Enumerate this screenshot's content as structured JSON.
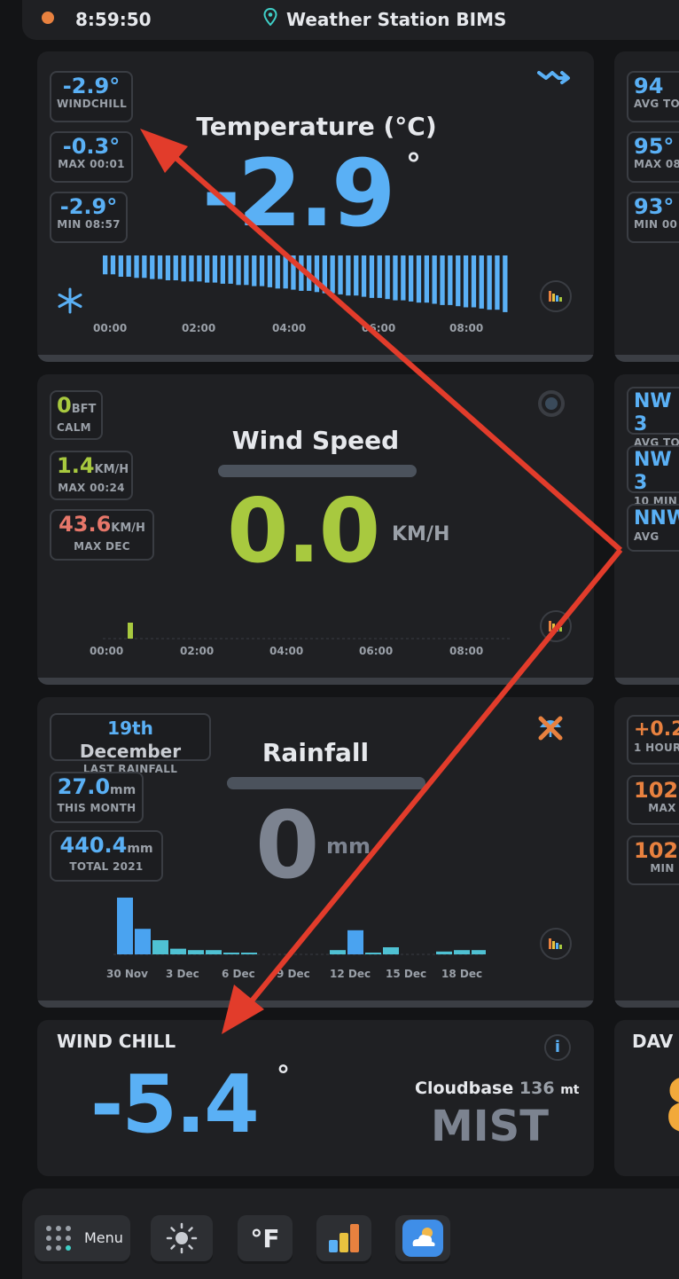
{
  "header": {
    "time": "8:59:50",
    "station": "Weather Station BIMS"
  },
  "temperature": {
    "title": "Temperature (°C)",
    "value": "-2.9",
    "unit": "°",
    "stats": [
      {
        "value": "-2.9°",
        "label": "WINDCHILL"
      },
      {
        "value": "-0.3°",
        "label": "MAX 00:01"
      },
      {
        "value": "-2.9°",
        "label": "MIN 08:57"
      }
    ],
    "axis": [
      "00:00",
      "02:00",
      "04:00",
      "06:00",
      "08:00"
    ],
    "trend": [
      0.9,
      0.9,
      0.88,
      0.88,
      0.87,
      0.87,
      0.86,
      0.86,
      0.85,
      0.85,
      0.84,
      0.84,
      0.84,
      0.83,
      0.83,
      0.82,
      0.82,
      0.81,
      0.81,
      0.8,
      0.8,
      0.79,
      0.78,
      0.78,
      0.77,
      0.76,
      0.76,
      0.75,
      0.74,
      0.74,
      0.73,
      0.72,
      0.72,
      0.71,
      0.7,
      0.7,
      0.69,
      0.68,
      0.68,
      0.67,
      0.66,
      0.66,
      0.65,
      0.64,
      0.64,
      0.63,
      0.62,
      0.62,
      0.61,
      0.6,
      0.6,
      0.58
    ]
  },
  "side_temp": [
    {
      "value": "94",
      "label": "AVG TO"
    },
    {
      "value": "95°",
      "label": "MAX 08"
    },
    {
      "value": "93°",
      "label": "MIN 00"
    }
  ],
  "wind": {
    "title": "Wind Speed",
    "value": "0.0",
    "unit": "KM/H",
    "stats": [
      {
        "value": "0",
        "unit": "BFT",
        "label": "CALM"
      },
      {
        "value": "1.4",
        "unit": "KM/H",
        "label": "MAX 00:24"
      },
      {
        "value": "43.6",
        "unit": "KM/H",
        "label": "MAX DEC"
      }
    ],
    "axis": [
      "00:00",
      "02:00",
      "04:00",
      "06:00",
      "08:00"
    ],
    "bar_value": 0.4
  },
  "side_wind": [
    {
      "value": "NW 3",
      "label": "AVG TO"
    },
    {
      "value": "NW 3",
      "label": "10 MIN"
    },
    {
      "value": "NNW",
      "label": "AVG"
    }
  ],
  "rain": {
    "title": "Rainfall",
    "value": "0",
    "unit": "mm",
    "stats": [
      {
        "value": "19th",
        "value2": "December",
        "label": "LAST RAINFALL"
      },
      {
        "value": "27.0",
        "unit": "mm",
        "label": "THIS MONTH"
      },
      {
        "value": "440.4",
        "unit": "mm",
        "label": "TOTAL 2021"
      }
    ],
    "axis": [
      "30 Nov",
      "3 Dec",
      "6 Dec",
      "9 Dec",
      "12 Dec",
      "15 Dec",
      "18 Dec"
    ],
    "daily_mm": [
      4.0,
      1.8,
      1.0,
      0.4,
      0.3,
      0.3,
      0.1,
      0.1,
      0,
      0,
      0,
      0,
      0.3,
      1.7,
      0.1,
      0.5,
      0,
      0,
      0.2,
      0.3,
      0.3
    ],
    "daily_color": [
      "#4aa3f0",
      "#4aa3f0",
      "#4fc1d3",
      "#4fc1d3",
      "#4fc1d3",
      "#4fc1d3",
      "#4fc1d3",
      "#4fc1d3",
      "#4fc1d3",
      "#4fc1d3",
      "#4fc1d3",
      "#4fc1d3",
      "#4fc1d3",
      "#4aa3f0",
      "#4fc1d3",
      "#4fc1d3",
      "#4fc1d3",
      "#4fc1d3",
      "#4fc1d3",
      "#4fc1d3",
      "#4fc1d3"
    ]
  },
  "side_rain": [
    {
      "value": "+0.2",
      "label": "1 HOUR"
    },
    {
      "value": "102",
      "label": "MAX"
    },
    {
      "value": "102",
      "label": "MIN"
    }
  ],
  "windchill": {
    "title": "WIND CHILL",
    "value": "-5.4",
    "unit": "°",
    "cloudbase_label": "Cloudbase",
    "cloudbase_value": "136",
    "cloudbase_unit": "mt",
    "condition": "MIST"
  },
  "side_bottom": {
    "title": "DAV",
    "value": "8"
  },
  "dock": {
    "menu_label": "Menu",
    "unit_label": "°F"
  },
  "colors": {
    "accent_blue": "#5ab0f5",
    "wind_green": "#a8c93f",
    "alert_red": "#e7776a",
    "annotation_red": "#e23c2b"
  }
}
